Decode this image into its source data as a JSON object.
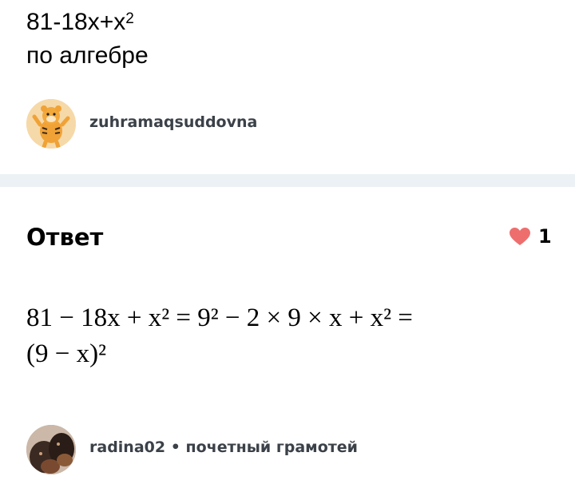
{
  "question": {
    "title_main": "81-18x+x",
    "title_exp": "2",
    "subject": "по алгебре",
    "author": "zuhramaqsuddovna"
  },
  "answer": {
    "heading": "Ответ",
    "likes": "1",
    "solution_line1": "81 − 18x + x² = 9² − 2 × 9 × x + x² =",
    "solution_line2": "(9 − x)²",
    "author": "radina02",
    "separator": " • ",
    "author_rank": "почетный грамотей"
  },
  "colors": {
    "divider": "#ecf1f5",
    "heart": "#ee6e6e",
    "username": "#3b4148"
  }
}
